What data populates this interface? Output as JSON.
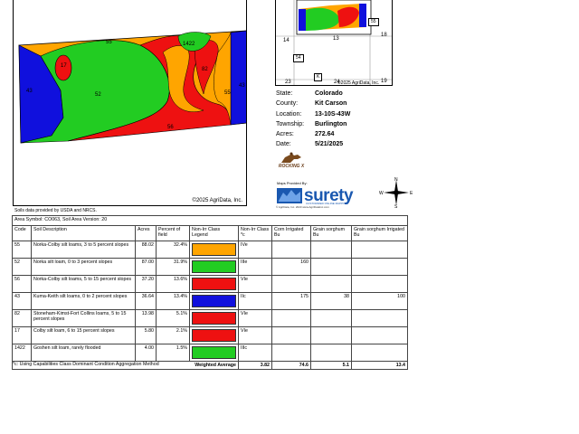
{
  "map": {
    "copyright": "©2025 AgriData, Inc.",
    "unit_labels": [
      "55",
      "1422",
      "43",
      "17",
      "52",
      "82",
      "55",
      "43",
      "56"
    ],
    "colors": {
      "orange": "#ffa500",
      "green": "#22cc22",
      "red": "#ee1111",
      "blue": "#1010dd"
    }
  },
  "soil_note": "Soils data provided by USDA and NRCS.",
  "locator": {
    "labels": [
      "14",
      "13",
      "18",
      "23",
      "24",
      "19"
    ],
    "roads": [
      "55",
      "54",
      "K"
    ],
    "copyright": "©2025 AgriData, Inc."
  },
  "info": {
    "rows": [
      {
        "key": "State:",
        "value": "Colorado"
      },
      {
        "key": "County:",
        "value": "Kit Carson"
      },
      {
        "key": "Location:",
        "value": "13-10S-43W"
      },
      {
        "key": "Township:",
        "value": "Burlington"
      },
      {
        "key": "Acres:",
        "value": "272.64"
      },
      {
        "key": "Date:",
        "value": "5/21/2025"
      }
    ]
  },
  "logos": {
    "rocking_x": "ROCKING X",
    "maps_provided_by": "Maps Provided By:",
    "surety": "surety",
    "surety_tagline": "CUSTOMIZED ONLINE MAPPING",
    "surety_footer": "© AgriData, Inc. 2023          www.AgriDataInc.com"
  },
  "compass": {
    "n": "N",
    "s": "S",
    "e": "E",
    "w": "W"
  },
  "table": {
    "area_symbol": "Area Symbol: CO063, Soil Area Version: 20",
    "headers": [
      "Code",
      "Soil Description",
      "Acres",
      "Percent of field",
      "Non-Irr Class Legend",
      "Non-Irr Class *c",
      "Corn Irrigated Bu",
      "Grain sorghum Bu",
      "Grain sorghum Irrigated Bu"
    ],
    "rows": [
      {
        "code": "55",
        "desc": "Norka-Colby silt loams, 3 to 5 percent slopes",
        "acres": "88.02",
        "pct": "32.4%",
        "color": "#ffa500",
        "cls": "IVe",
        "corn": "",
        "gs": "",
        "gsi": ""
      },
      {
        "code": "52",
        "desc": "Norka silt loam, 0 to 3 percent slopes",
        "acres": "87.00",
        "pct": "31.9%",
        "color": "#22cc22",
        "cls": "IIIe",
        "corn": "160",
        "gs": "",
        "gsi": ""
      },
      {
        "code": "56",
        "desc": "Norka-Colby silt loams, 5 to 15 percent slopes",
        "acres": "37.20",
        "pct": "13.6%",
        "color": "#ee1111",
        "cls": "VIe",
        "corn": "",
        "gs": "",
        "gsi": ""
      },
      {
        "code": "43",
        "desc": "Kuma-Keith silt loams, 0 to 2 percent slopes",
        "acres": "36.64",
        "pct": "13.4%",
        "color": "#1010dd",
        "cls": "IIc",
        "corn": "175",
        "gs": "38",
        "gsi": "100"
      },
      {
        "code": "82",
        "desc": "Stoneham-Kimst-Fort Collins loams, 5 to 15 percent slopes",
        "acres": "13.98",
        "pct": "5.1%",
        "color": "#ee1111",
        "cls": "VIe",
        "corn": "",
        "gs": "",
        "gsi": ""
      },
      {
        "code": "17",
        "desc": "Colby silt loam, 6 to 15 percent slopes",
        "acres": "5.80",
        "pct": "2.1%",
        "color": "#ee1111",
        "cls": "VIe",
        "corn": "",
        "gs": "",
        "gsi": ""
      },
      {
        "code": "1422",
        "desc": "Goshen silt loam, rarely flooded",
        "acres": "4.00",
        "pct": "1.5%",
        "color": "#22cc22",
        "cls": "IIIc",
        "corn": "",
        "gs": "",
        "gsi": ""
      }
    ],
    "total": {
      "label": "Weighted Average",
      "cls": "3.82",
      "corn": "74.6",
      "gs": "5.1",
      "gsi": "13.4"
    }
  },
  "footnote": "*c: Using Capabilities Class Dominant Condition Aggregation Method"
}
